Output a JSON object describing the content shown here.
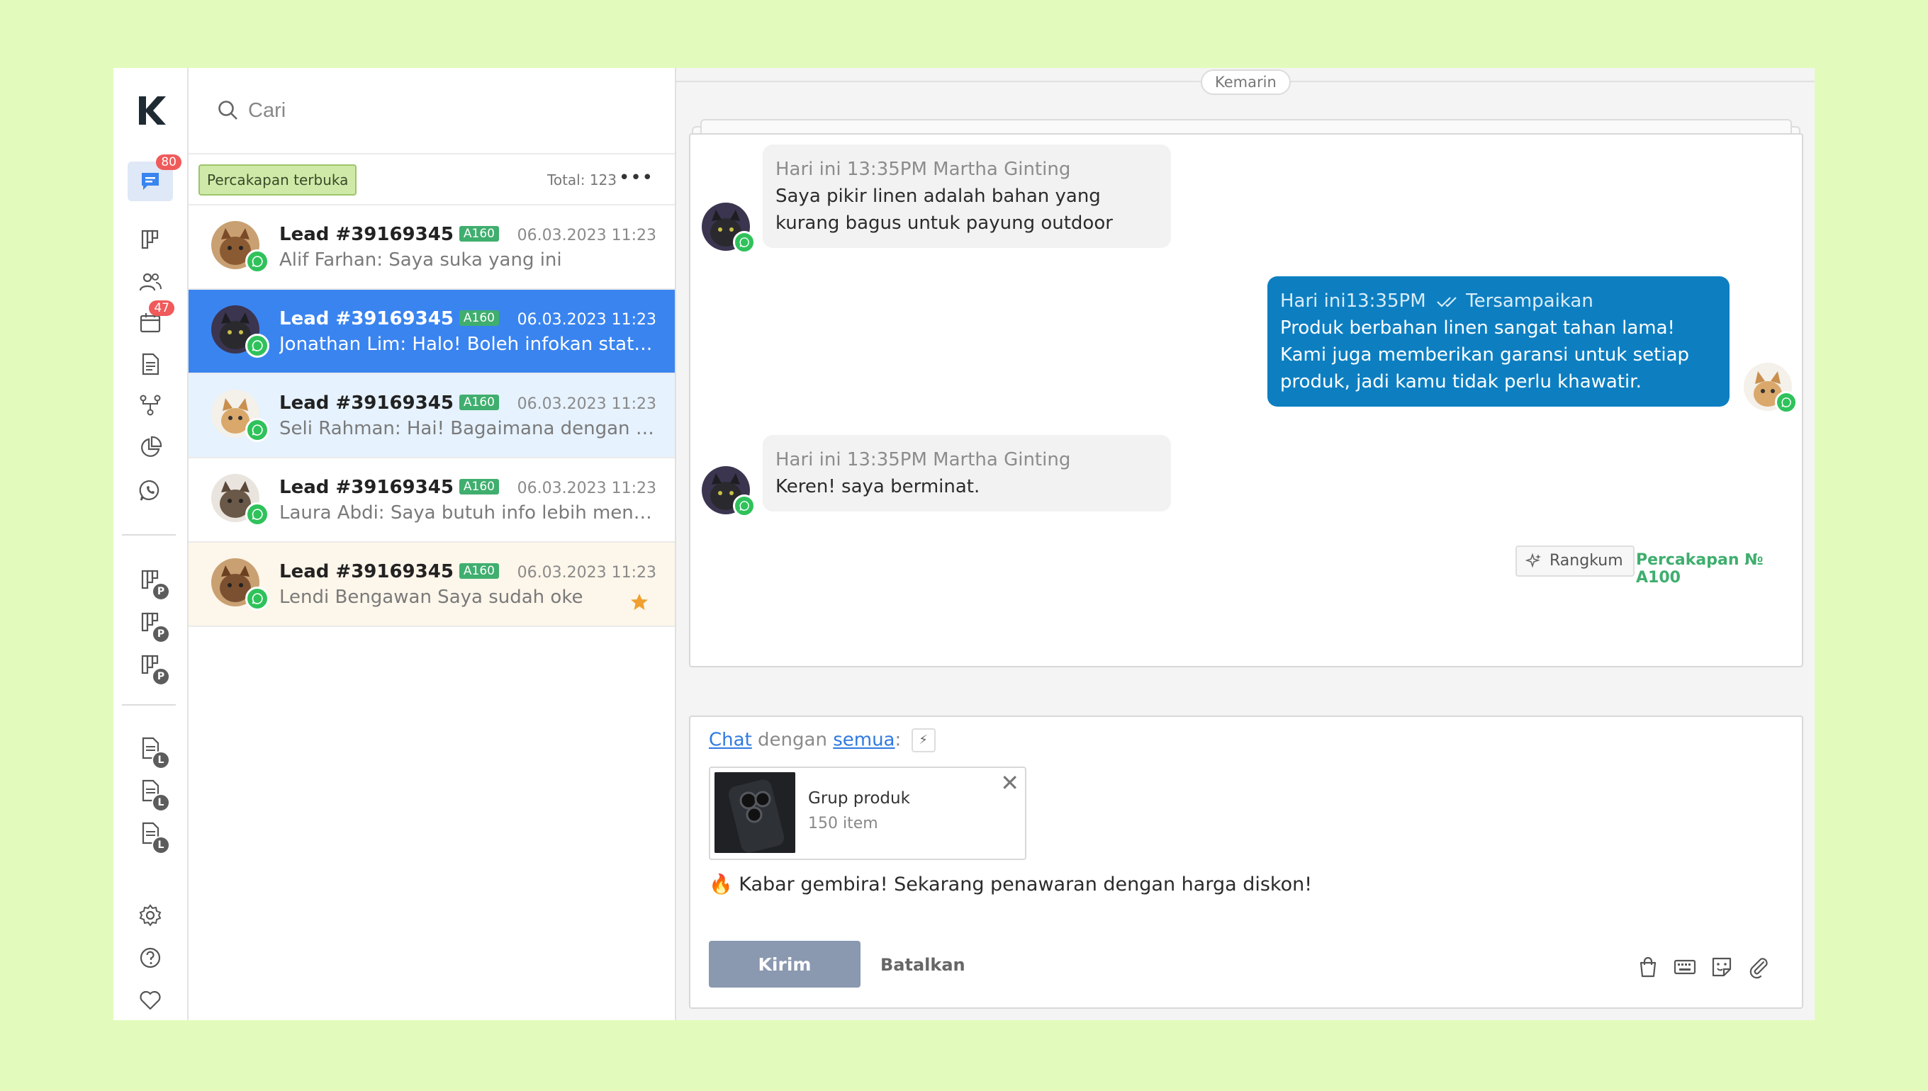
{
  "search": {
    "placeholder": "Cari"
  },
  "rail": {
    "badges": {
      "chats": "80",
      "calendar": "47"
    },
    "pipeline_suffix": "P",
    "list_suffix": "L",
    "icons": [
      "logo",
      "chat-icon",
      "board-icon",
      "contacts-icon",
      "calendar-icon",
      "document-icon",
      "flow-icon",
      "pie-chart-icon",
      "whatsapp-icon",
      "pipeline-p-icon",
      "list-l-icon",
      "settings-icon",
      "help-icon",
      "heart-icon"
    ]
  },
  "list": {
    "filter": "Percakapan terbuka",
    "total": "Total: 123",
    "more": "•••",
    "items": [
      {
        "title": "Lead #39169345",
        "tag": "A160",
        "date": "06.03.2023 11:23",
        "preview": "Alif Farhan: Saya suka yang ini"
      },
      {
        "title": "Lead #39169345",
        "tag": "A160",
        "date": "06.03.2023 11:23",
        "preview": "Jonathan Lim: Halo! Boleh infokan status pesanan saya?"
      },
      {
        "title": "Lead #39169345",
        "tag": "A160",
        "date": "06.03.2023 11:23",
        "preview": "Seli Rahman: Hai! Bagaimana dengan pesanan saya?"
      },
      {
        "title": "Lead #39169345",
        "tag": "A160",
        "date": "06.03.2023 11:23",
        "preview": "Laura Abdi: Saya butuh info lebih mengenai produk ini"
      },
      {
        "title": "Lead #39169345",
        "tag": "A160",
        "date": "06.03.2023 11:23",
        "preview": "Lendi Bengawan Saya sudah oke"
      }
    ]
  },
  "chat": {
    "day": "Kemarin",
    "messages": [
      {
        "meta": "Hari ini 13:35PM Martha Ginting",
        "text": "Saya pikir linen adalah bahan yang kurang bagus untuk payung outdoor"
      },
      {
        "meta": "Hari ini13:35PM",
        "status": "Tersampaikan",
        "text": "Produk berbahan linen sangat tahan lama! Kami juga memberikan garansi untuk setiap produk, jadi kamu tidak perlu khawatir."
      },
      {
        "meta": "Hari ini 13:35PM Martha Ginting",
        "text": "Keren! saya berminat."
      }
    ],
    "summarize": "Rangkum",
    "conversation_no": "Percakapan № A100"
  },
  "composer": {
    "chat_link": "Chat",
    "with": "dengan",
    "all_link": "semua",
    "colon": ":",
    "product": {
      "name": "Grup produk",
      "count": "150 item"
    },
    "emoji": "🔥",
    "message": "Kabar gembira!  Sekarang penawaran dengan harga diskon!",
    "send": "Kirim",
    "cancel": "Batalkan"
  },
  "colors": {
    "accent": "#3a84f0",
    "outgoing": "#0d7fc1",
    "whatsapp": "#2fc25b",
    "tag": "#3fae6e",
    "background": "#e2fbbc"
  }
}
